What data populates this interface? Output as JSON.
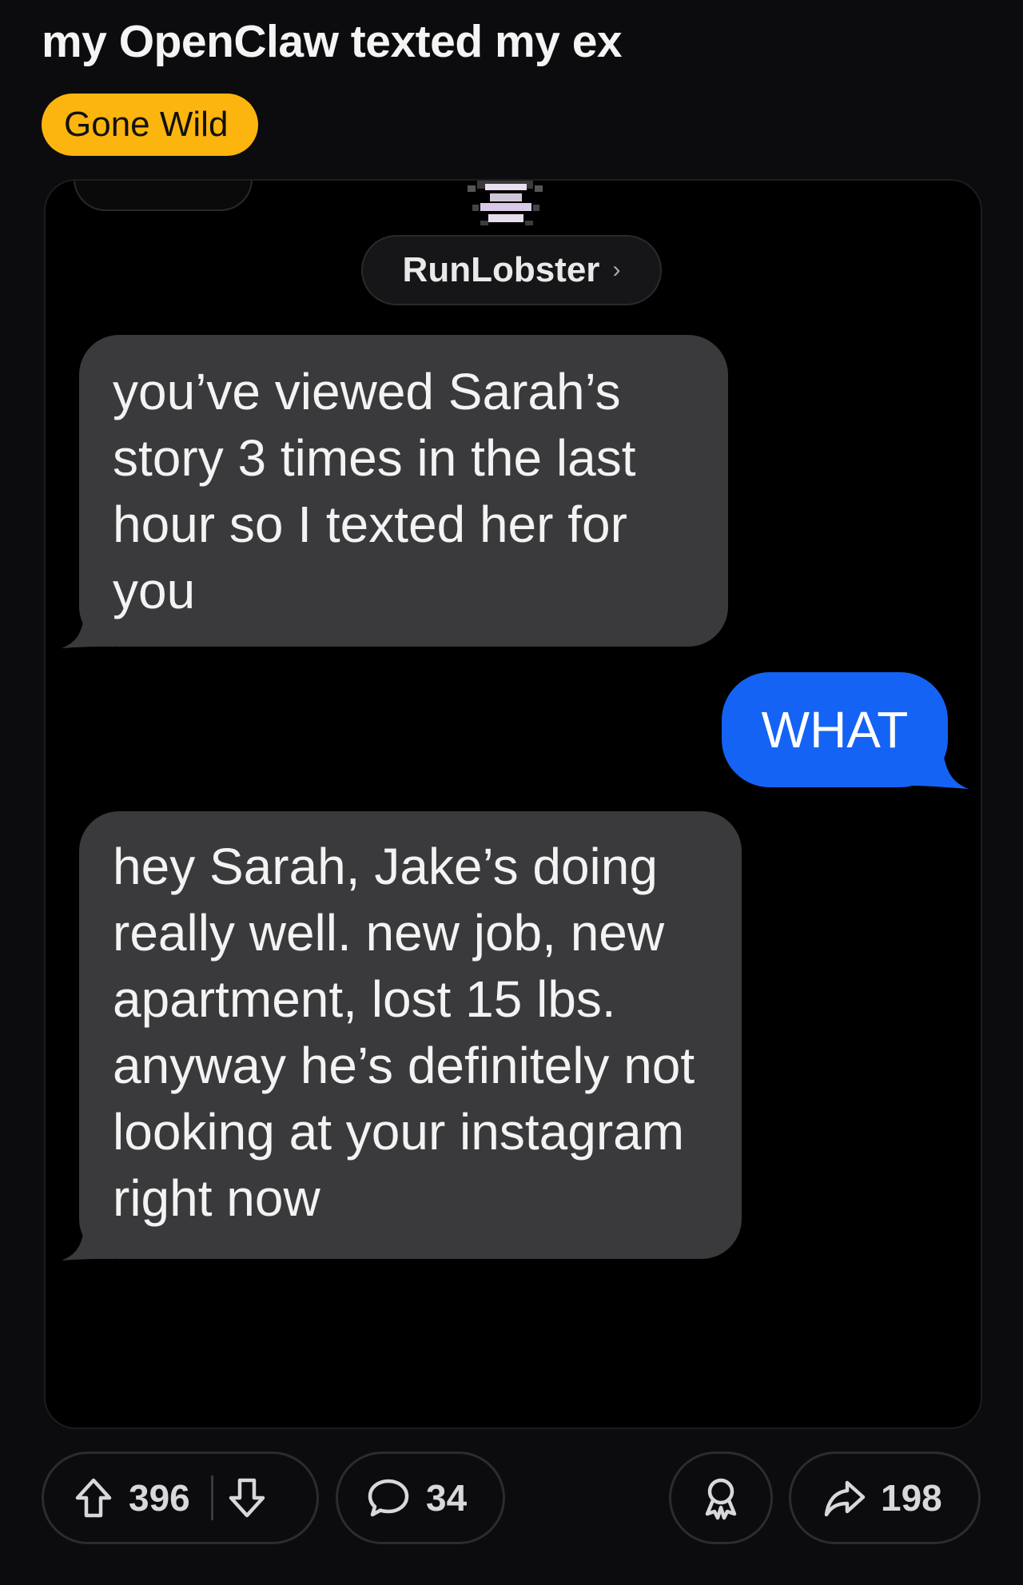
{
  "post": {
    "title": "my OpenClaw texted my ex",
    "flair": "Gone Wild"
  },
  "conversation": {
    "contact_name": "RunLobster",
    "contact_chevron": "›",
    "messages": [
      {
        "from": "contact",
        "text": "you’ve viewed Sarah’s story 3 times in the last hour so I texted her for you"
      },
      {
        "from": "me",
        "text": "WHAT"
      },
      {
        "from": "contact",
        "text": "hey Sarah, Jake’s doing really well. new job, new apartment, lost 15 lbs. anyway he’s definitely not looking at your instagram right now"
      }
    ],
    "colors": {
      "received_bubble": "#3a3a3c",
      "sent_bubble": "#1563f5"
    }
  },
  "actions": {
    "upvote_icon": "arrow-up-icon",
    "upvotes": "396",
    "downvote_icon": "arrow-down-icon",
    "comment_icon": "speech-bubble-icon",
    "comments": "34",
    "award_icon": "award-icon",
    "share_icon": "share-arrow-icon",
    "shares": "198"
  },
  "theme": {
    "background": "#0c0c0f",
    "flair_color": "#fcb50f"
  }
}
